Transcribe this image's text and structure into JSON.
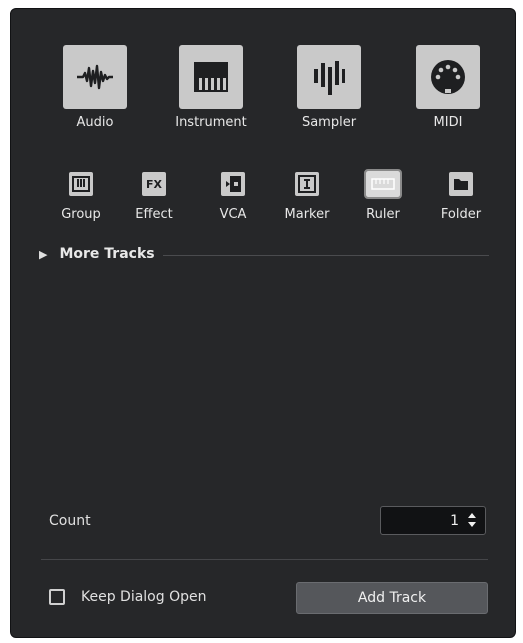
{
  "track_types": {
    "primary": [
      {
        "label": "Audio",
        "icon": "audio-waveform-icon"
      },
      {
        "label": "Instrument",
        "icon": "piano-keys-icon"
      },
      {
        "label": "Sampler",
        "icon": "sampler-bars-icon"
      },
      {
        "label": "MIDI",
        "icon": "midi-connector-icon"
      }
    ],
    "secondary": [
      {
        "label": "Group",
        "icon": "group-faders-icon"
      },
      {
        "label": "Effect",
        "icon": "fx-icon",
        "glyph": "FX"
      },
      {
        "label": "VCA",
        "icon": "vca-icon"
      },
      {
        "label": "Marker",
        "icon": "marker-icon"
      },
      {
        "label": "Ruler",
        "icon": "ruler-icon",
        "selected": true
      },
      {
        "label": "Folder",
        "icon": "folder-icon"
      }
    ]
  },
  "more_tracks": {
    "arrow": "▶",
    "label": "More Tracks"
  },
  "count": {
    "label": "Count",
    "value": "1"
  },
  "keep_dialog_open": {
    "label": "Keep Dialog Open",
    "checked": false
  },
  "add_track_button": {
    "label": "Add Track"
  },
  "colors": {
    "dialog_bg": "#262729",
    "tile_bg": "#c9c9c9",
    "icon_fg": "#1e1f21",
    "button_bg": "#55575b"
  }
}
